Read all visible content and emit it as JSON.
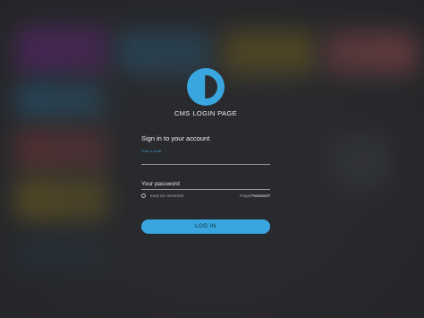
{
  "app": {
    "title": "CMS LOGIN PAGE"
  },
  "form": {
    "heading": "Sign in to your account",
    "email_label": "Your e-mail",
    "email_value": "",
    "password_placeholder": "Your password",
    "keep_label": "Keep me connected",
    "forgot_prefix": "Forgot",
    "forgot_link": "Password?",
    "login_label": "LOG IN"
  },
  "colors": {
    "accent": "#3aa6e0",
    "background": "#2b2c2f"
  },
  "icons": {
    "logo": "half-circle-logo-icon",
    "checkbox": "radio-circle-icon"
  }
}
